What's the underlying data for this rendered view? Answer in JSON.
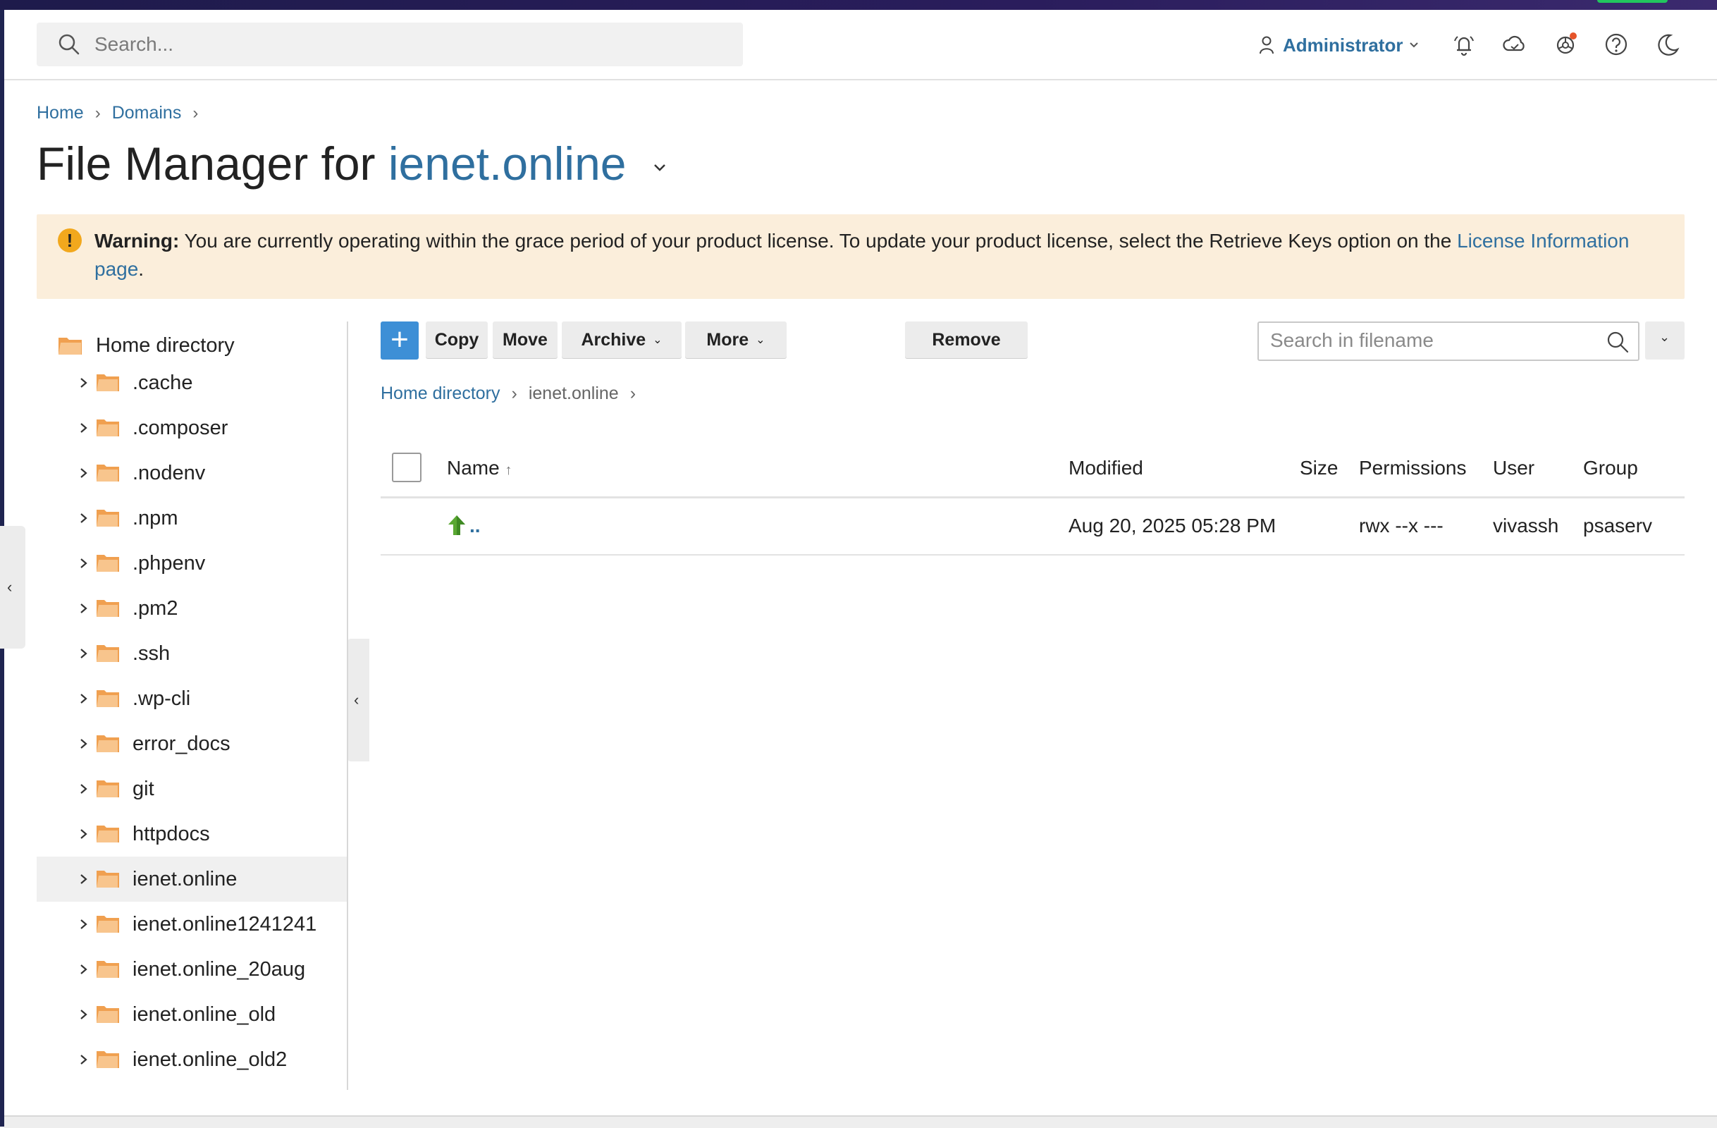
{
  "header": {
    "search_placeholder": "Search...",
    "user_label": "Administrator"
  },
  "breadcrumb": [
    "Home",
    "Domains"
  ],
  "page": {
    "title_prefix": "File Manager for",
    "domain": "ienet.online"
  },
  "warning": {
    "badge": "!",
    "label": "Warning:",
    "text": " You are currently operating within the grace period of your product license. To update your product license, select the Retrieve Keys option on the ",
    "link": "License Information page",
    "end": "."
  },
  "tree": {
    "root": "Home directory",
    "items": [
      ".cache",
      ".composer",
      ".nodenv",
      ".npm",
      ".phpenv",
      ".pm2",
      ".ssh",
      ".wp-cli",
      "error_docs",
      "git",
      "httpdocs",
      "ienet.online",
      "ienet.online1241241",
      "ienet.online_20aug",
      "ienet.online_old",
      "ienet.online_old2"
    ],
    "selected": "ienet.online"
  },
  "toolbar": {
    "add": "+",
    "copy": "Copy",
    "move": "Move",
    "archive": "Archive",
    "more": "More",
    "remove": "Remove",
    "search_placeholder": "Search in filename"
  },
  "path": {
    "root": "Home directory",
    "current": "ienet.online"
  },
  "table": {
    "columns": {
      "name": "Name",
      "sort_indicator": "↑",
      "modified": "Modified",
      "size": "Size",
      "permissions": "Permissions",
      "user": "User",
      "group": "Group"
    },
    "rows": [
      {
        "name": "..",
        "modified": "Aug 20, 2025 05:28 PM",
        "size": "",
        "permissions": "rwx --x ---",
        "user": "vivassh",
        "group": "psaserv"
      }
    ]
  },
  "colors": {
    "accent": "#2f6f9f",
    "primary_button": "#3d8fd6",
    "warning_bg": "#fbeedb",
    "folder": "#f0a050"
  }
}
